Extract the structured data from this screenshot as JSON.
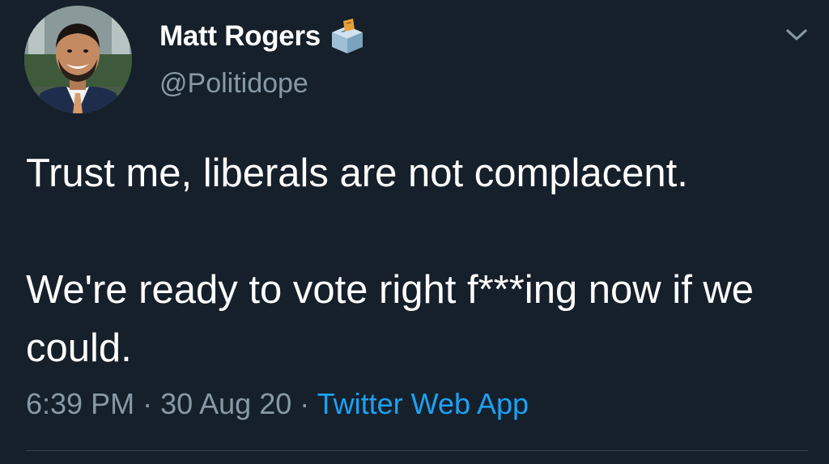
{
  "tweet": {
    "author": {
      "display_name": "Matt Rogers",
      "handle": "@Politidope",
      "avatar_icon": "profile-photo",
      "badge_icon": "ballot-box-icon"
    },
    "menu_icon": "chevron-down-icon",
    "text_paragraphs": [
      "Trust me, liberals are not complacent.",
      "We're ready to vote right f***ing now if we could."
    ],
    "meta": {
      "time": "6:39 PM",
      "separator": " · ",
      "date": "30 Aug 20",
      "source": "Twitter Web App"
    }
  },
  "colors": {
    "background": "#15202b",
    "primary_text": "#ffffff",
    "secondary_text": "#8899a6",
    "link": "#1da1f2",
    "divider": "#38444d"
  }
}
